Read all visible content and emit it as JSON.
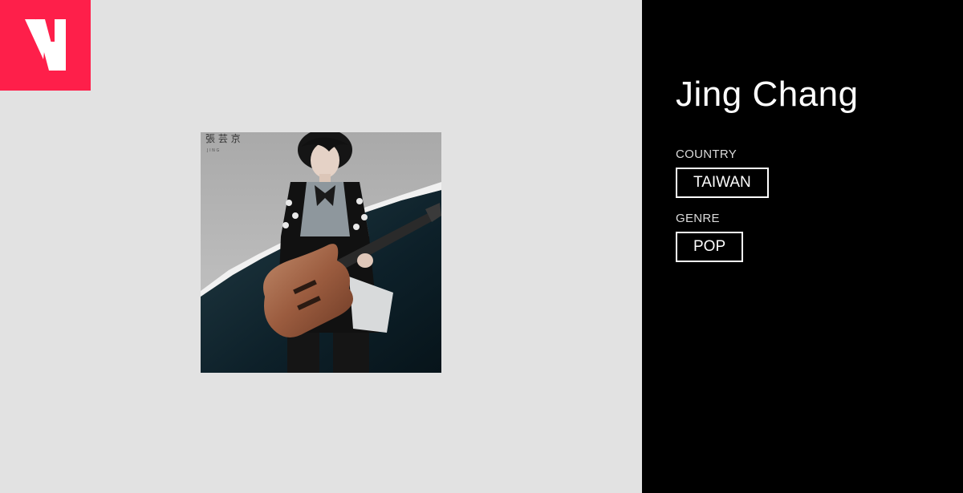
{
  "logo": {
    "letter": "V",
    "color": "#fe1f4a"
  },
  "cover": {
    "title_glyphs": "張 芸 京",
    "subtitle": "J I N G",
    "description": "album cover art: artist with electric guitar"
  },
  "artist": {
    "name": "Jing Chang",
    "country_label": "COUNTRY",
    "country": "TAIWAN",
    "genre_label": "GENRE",
    "genre": "POP"
  },
  "colors": {
    "left_background": "#e2e2e2",
    "right_background": "#000000",
    "text": "#ffffff",
    "accent": "#fe1f4a"
  }
}
